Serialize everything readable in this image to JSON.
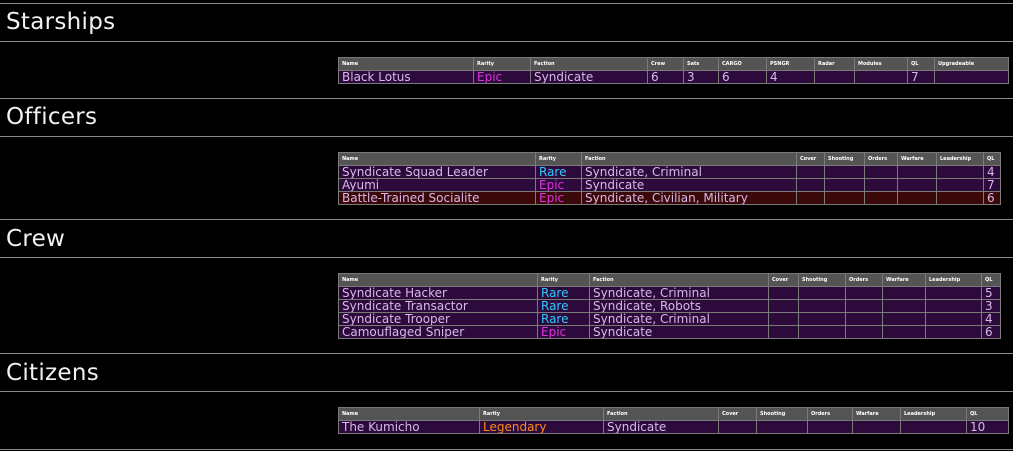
{
  "sections": {
    "starships": {
      "title": "Starships",
      "headers": [
        "Name",
        "Rarity",
        "Faction",
        "Crew",
        "Sats",
        "CARGO",
        "PSNGR",
        "Radar",
        "Modules",
        "QL",
        "Upgradeable"
      ],
      "rows": [
        {
          "name": "Black Lotus",
          "rarity": "Epic",
          "faction": "Syndicate",
          "crew": "6",
          "sats": "3",
          "cargo": "6",
          "psngr": "4",
          "radar": "",
          "modules": "",
          "ql": "7",
          "upgradeable": ""
        }
      ]
    },
    "officers": {
      "title": "Officers",
      "headers": [
        "Name",
        "Rarity",
        "Faction",
        "Cover",
        "Shooting",
        "Orders",
        "Warfare",
        "Leadership",
        "QL"
      ],
      "rows": [
        {
          "name": "Syndicate Squad Leader",
          "rarity": "Rare",
          "faction": "Syndicate, Criminal",
          "cover": "",
          "shooting": "",
          "orders": "",
          "warfare": "",
          "leadership": "",
          "ql": "4"
        },
        {
          "name": "Ayumi",
          "rarity": "Epic",
          "faction": "Syndicate",
          "cover": "",
          "shooting": "",
          "orders": "",
          "warfare": "",
          "leadership": "",
          "ql": "7"
        },
        {
          "name": "Battle-Trained Socialite",
          "rarity": "Epic",
          "faction": "Syndicate, Civilian, Military",
          "cover": "",
          "shooting": "",
          "orders": "",
          "warfare": "",
          "leadership": "",
          "ql": "6"
        }
      ]
    },
    "crew": {
      "title": "Crew",
      "headers": [
        "Name",
        "Rarity",
        "Faction",
        "Cover",
        "Shooting",
        "Orders",
        "Warfare",
        "Leadership",
        "QL"
      ],
      "rows": [
        {
          "name": "Syndicate Hacker",
          "rarity": "Rare",
          "faction": "Syndicate, Criminal",
          "cover": "",
          "shooting": "",
          "orders": "",
          "warfare": "",
          "leadership": "",
          "ql": "5"
        },
        {
          "name": "Syndicate Transactor",
          "rarity": "Rare",
          "faction": "Syndicate, Robots",
          "cover": "",
          "shooting": "",
          "orders": "",
          "warfare": "",
          "leadership": "",
          "ql": "3"
        },
        {
          "name": "Syndicate Trooper",
          "rarity": "Rare",
          "faction": "Syndicate, Criminal",
          "cover": "",
          "shooting": "",
          "orders": "",
          "warfare": "",
          "leadership": "",
          "ql": "4"
        },
        {
          "name": "Camouflaged Sniper",
          "rarity": "Epic",
          "faction": "Syndicate",
          "cover": "",
          "shooting": "",
          "orders": "",
          "warfare": "",
          "leadership": "",
          "ql": "6"
        }
      ]
    },
    "citizens": {
      "title": "Citizens",
      "headers": [
        "Name",
        "Rarity",
        "Faction",
        "Cover",
        "Shooting",
        "Orders",
        "Warfare",
        "Leadership",
        "QL"
      ],
      "rows": [
        {
          "name": "The Kumicho",
          "rarity": "Legendary",
          "faction": "Syndicate",
          "cover": "",
          "shooting": "",
          "orders": "",
          "warfare": "",
          "leadership": "",
          "ql": "10"
        }
      ]
    }
  },
  "colors": {
    "rarity_epic": "#e030e0",
    "rarity_rare": "#30c8ff",
    "rarity_legendary": "#ff8a1a",
    "row_purple": "#2c0a3c",
    "row_red": "#3a0808",
    "header_bg": "#545454"
  }
}
